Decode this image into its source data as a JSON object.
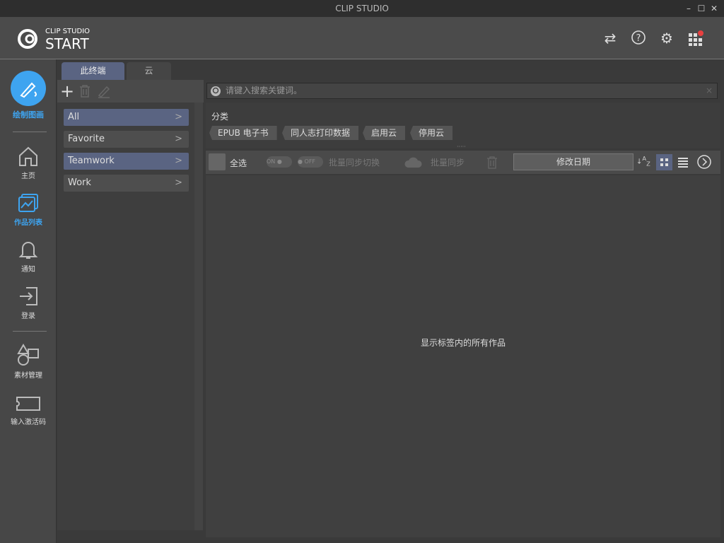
{
  "window": {
    "title": "CLIP STUDIO",
    "min": "–",
    "max": "☐",
    "close": "✕"
  },
  "header": {
    "logo_small": "CLIP STUDIO",
    "logo_big": "START",
    "notification_color": "#e84040"
  },
  "nav": {
    "items": [
      {
        "label": "绘制图画"
      },
      {
        "label": "主页"
      },
      {
        "label": "作品列表"
      },
      {
        "label": "通知"
      },
      {
        "label": "登录"
      },
      {
        "label": "素材管理"
      },
      {
        "label": "输入激活码"
      }
    ],
    "accent": "#3ea4f0"
  },
  "tabs": [
    {
      "label": "此终端"
    },
    {
      "label": "云"
    }
  ],
  "categories": [
    {
      "label": "All"
    },
    {
      "label": "Favorite"
    },
    {
      "label": "Teamwork"
    },
    {
      "label": "Work"
    }
  ],
  "search": {
    "placeholder": "请键入搜索关键词。",
    "clear": "×"
  },
  "filter": {
    "title": "分类",
    "tags": [
      "EPUB 电子书",
      "同人志打印数据",
      "启用云",
      "停用云"
    ]
  },
  "toolbar": {
    "select_all": "全选",
    "on": "ON",
    "off": "OFF",
    "sync_toggle": "批量同步切换",
    "batch_sync": "批量同步",
    "sort": "修改日期"
  },
  "content": {
    "empty_message": "显示标签内的所有作品"
  }
}
